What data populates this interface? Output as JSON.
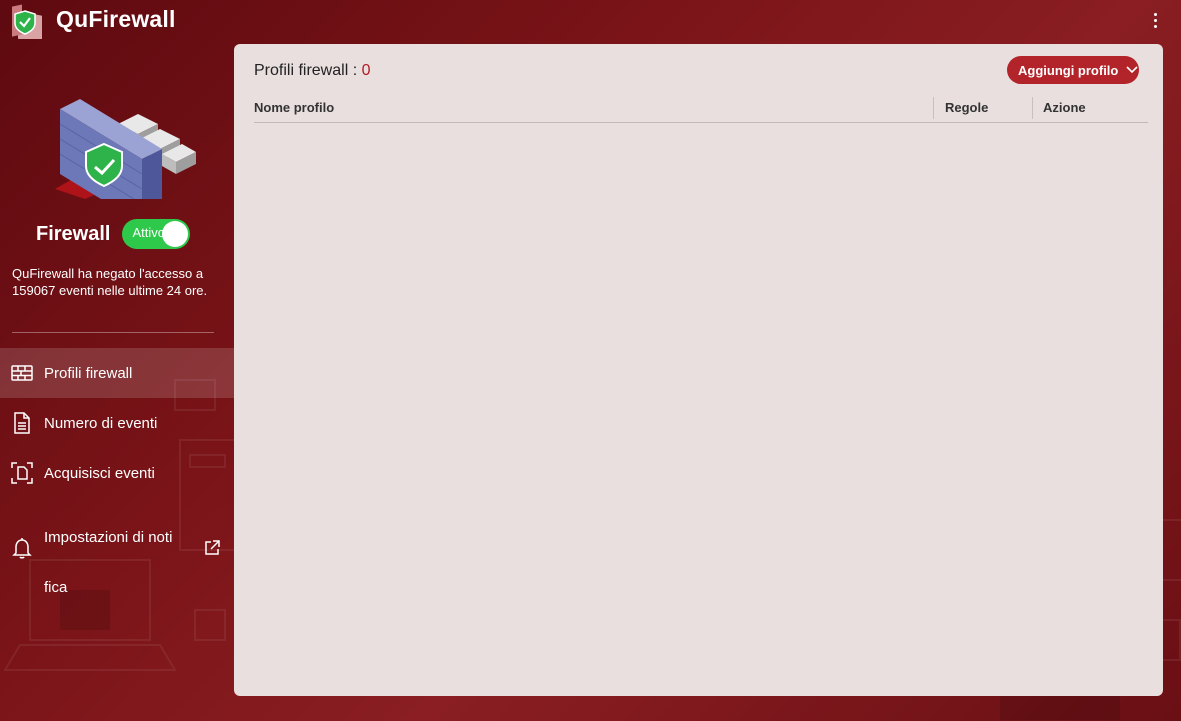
{
  "header": {
    "title": "QuFirewall",
    "more_icon": "more-vertical-icon"
  },
  "sidebar": {
    "firewall_label": "Firewall",
    "toggle_label": "Attivo",
    "toggle_on": true,
    "description": "QuFirewall ha negato l'accesso a 159067 eventi nelle ultime 24 ore.",
    "items": [
      {
        "label": "Profili firewall",
        "icon": "firewall-icon",
        "active": true
      },
      {
        "label": "Numero di eventi",
        "icon": "document-icon",
        "active": false
      },
      {
        "label": "Acquisisci eventi",
        "icon": "capture-icon",
        "active": false
      },
      {
        "label": "Impostazioni di notifica",
        "label_line1": "Impostazioni di noti",
        "label_line2": "fica",
        "icon": "bell-icon",
        "external_icon": "external-link-icon",
        "active": false
      }
    ]
  },
  "main": {
    "title": "Profili firewall : ",
    "count": "0",
    "add_button": "Aggiungi profilo",
    "columns": [
      "Nome profilo",
      "Regole",
      "Azione"
    ],
    "rows": []
  },
  "colors": {
    "accent": "#b2242a",
    "toggle_on": "#2ec84a",
    "panel_bg": "#e8dfde"
  }
}
